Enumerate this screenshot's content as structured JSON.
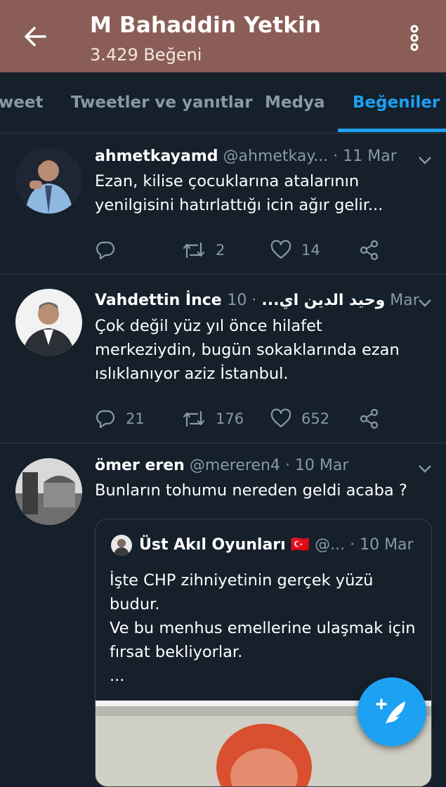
{
  "header": {
    "title": "M Bahaddin Yetkin",
    "subtitle": "3.429 Beğeni",
    "bg_color": "#8a5e56",
    "back_icon": "arrow-left-icon",
    "menu_icon": "more-vertical-icon"
  },
  "tabs": [
    {
      "label": "weet",
      "active": false
    },
    {
      "label": "Tweetler ve yanıtlar",
      "active": false
    },
    {
      "label": "Medya",
      "active": false
    },
    {
      "label": "Beğeniler",
      "active": true
    }
  ],
  "tweets": [
    {
      "name": "ahmetkayamd",
      "handle": "@ahmetkay...",
      "dot": "·",
      "date": "11 Mar",
      "text": "Ezan, kilise çocuklarına atalarının yenilgisini hatırlattığı icin ağır gelir...",
      "reply_count": "",
      "retweet_count": "2",
      "like_count": "14"
    },
    {
      "name": "Vahdettin İnce وحيد الدين اي...",
      "handle": "",
      "dot": "·",
      "date": "10 Mar",
      "text": "Çok değil yüz yıl önce hilafet merkeziydin, bugün sokaklarında ezan ıslıklanıyor aziz İstanbul.",
      "reply_count": "21",
      "retweet_count": "176",
      "like_count": "652"
    },
    {
      "name": "ömer eren",
      "handle": "@mereren4",
      "dot": "·",
      "date": "10 Mar",
      "text": "Bunların tohumu nereden geldi acaba ?",
      "quote": {
        "name": "Üst Akıl Oyunları",
        "flag": "🇹🇷",
        "handle": "@...",
        "dot": "·",
        "date": "10 Mar",
        "text": "İşte CHP zihniyetinin gerçek yüzü budur.\nVe bu menhus emellerine ulaşmak için fırsat bekliyorlar.\n ..."
      }
    }
  ],
  "colors": {
    "background": "#15202b",
    "accent": "#1da1f2",
    "muted": "#8899a6",
    "divider": "#2f3b47"
  },
  "fab_icon": "compose-tweet-icon"
}
